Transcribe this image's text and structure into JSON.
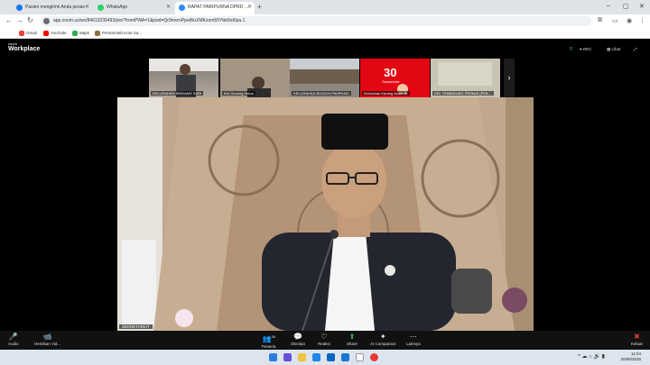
{
  "browser": {
    "tabs": [
      {
        "title": "Pasien mengirimi Anda pesan",
        "color": "#1877f2"
      },
      {
        "title": "WhatsApp",
        "color": "#25d366"
      },
      {
        "title": "RAPAT PARIPURNA DPRD …",
        "color": "#2d8cff"
      }
    ],
    "new_tab": "+",
    "url": "app.zoom.us/wc/84613235493/join?fromPWA=1&pwd=Qr9mvrnPpaWuXMKzom55Ybb0o6Ipa.1",
    "window_controls": [
      "–",
      "▢",
      "✕"
    ]
  },
  "bookmarks": [
    {
      "label": "Gmail",
      "color": "#ea4335"
    },
    {
      "label": "YouTube",
      "color": "#ff0000"
    },
    {
      "label": "Maps",
      "color": "#34a853"
    },
    {
      "label": "Pemerintah Kota Sa...",
      "color": "#8a6d3b"
    }
  ],
  "zoom": {
    "logo_small": "zoom",
    "logo_big": "Workplace",
    "rec": "● REC",
    "view": "Lihat",
    "participants": [
      {
        "label": "KELURAHAN SINDANG SARI",
        "bg": "#9a8f84"
      },
      {
        "label": "Ket Gunung Kelua",
        "bg": "#8a7a6c"
      },
      {
        "label": "KELURAHAN BUDAYA PAMPANG",
        "bg": "#7c7f82"
      },
      {
        "label": "Kelurahan Karang Asam Ilir",
        "bg": "#e30613",
        "logo": "30",
        "logo_sub": "Samarinda"
      },
      {
        "label": "KEL TEMINDUNG PERMAI (PEB…",
        "bg": "#b9b7a8"
      }
    ],
    "next_arrow": "›",
    "speaker_label": "SEKRETARIAT",
    "toolbar": [
      {
        "label": "Audio",
        "glyph": "🎤"
      },
      {
        "label": "Hentikan Vid...",
        "glyph": "📹"
      },
      {
        "label": "Peserta",
        "glyph": "👥",
        "count": "34"
      },
      {
        "label": "Obrolan",
        "glyph": "💬"
      },
      {
        "label": "Reaksi",
        "glyph": "♡"
      },
      {
        "label": "Share",
        "glyph": "⬆"
      },
      {
        "label": "AI Companion",
        "glyph": "✦"
      },
      {
        "label": "Lainnya",
        "glyph": "⋯"
      }
    ],
    "leave_label": "Keluar",
    "leave_glyph": "✖"
  },
  "taskbar": {
    "time": "11:04",
    "date": "20/08/2025",
    "tray": "^  ☁  ⌂  🔊  ▮"
  }
}
